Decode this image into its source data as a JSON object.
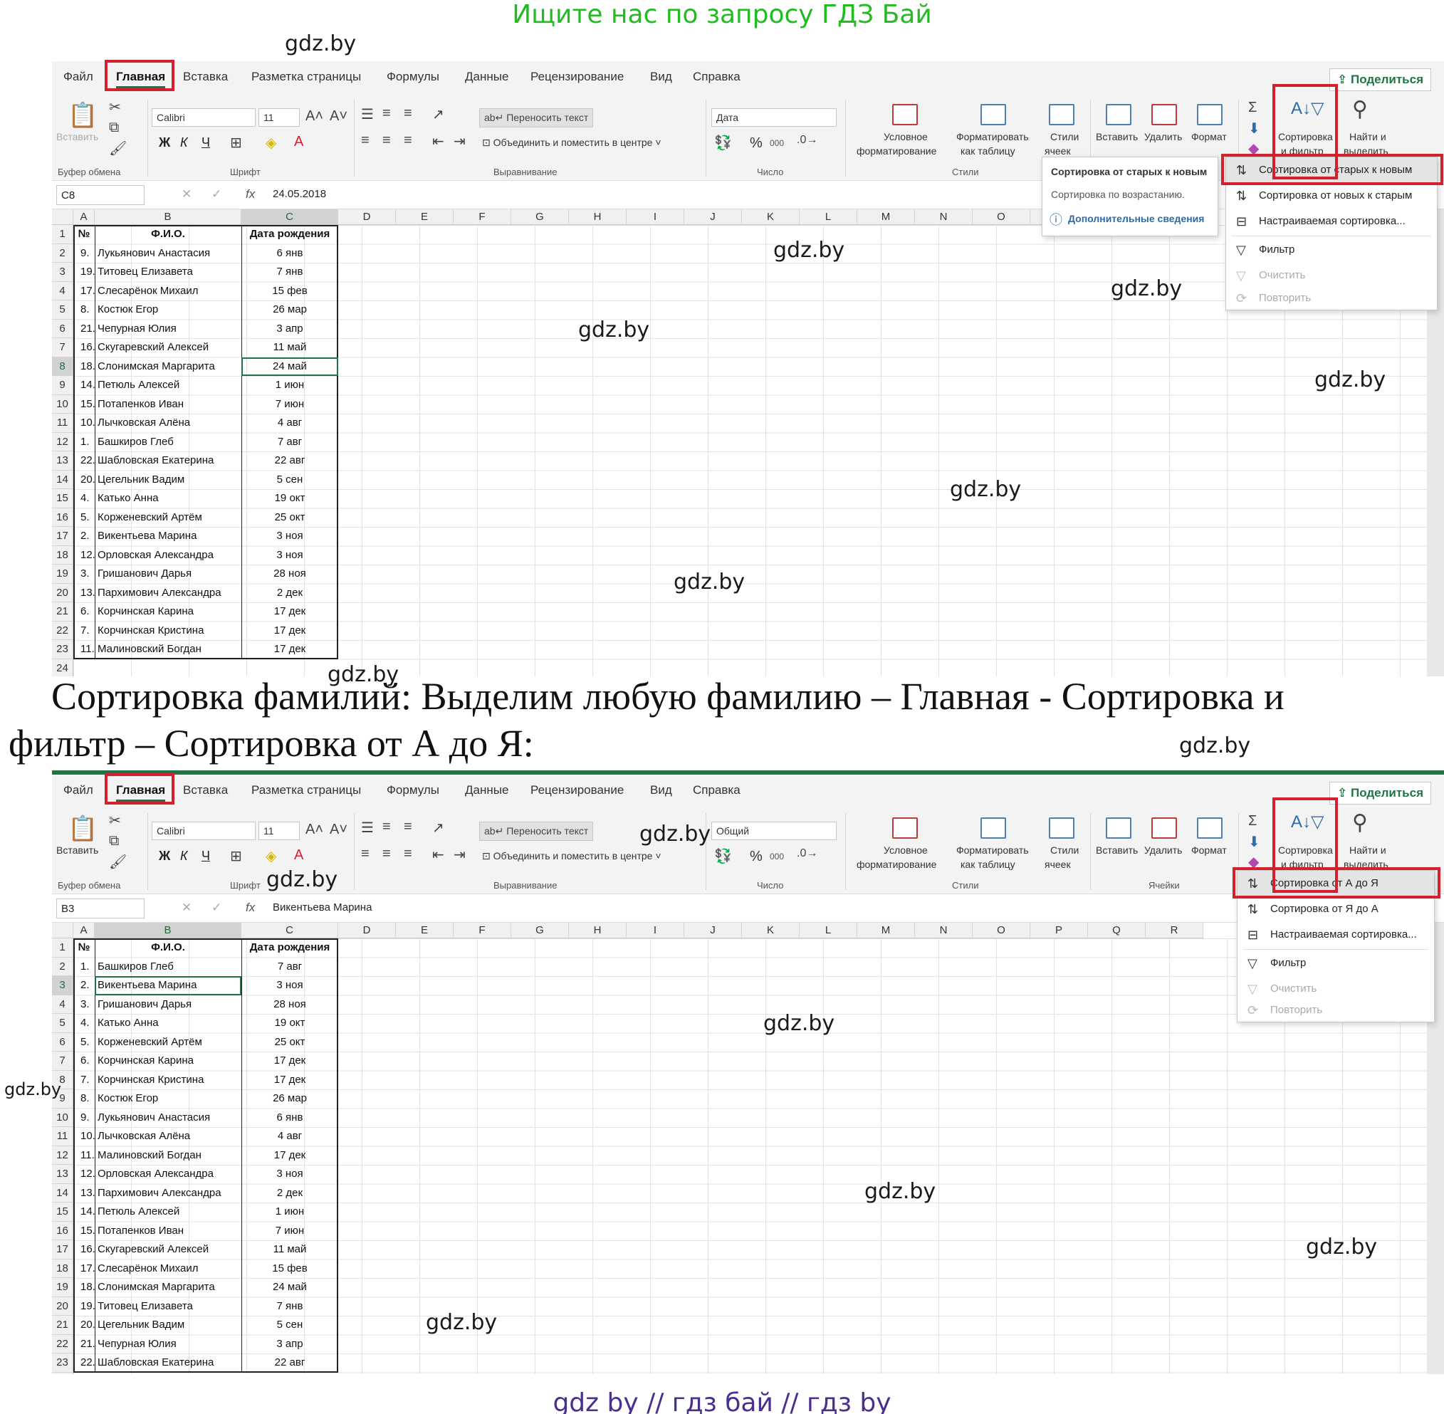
{
  "banner_top": "Ищите нас по запросу ГДЗ Бай",
  "banner_bottom": "gdz by  //  гдз бай  //  гдз by",
  "watermark": "gdz.by",
  "caption": {
    "line1": "Сортировка фамилий: Выделим любую фамилию – Главная -  Сортировка и",
    "line2": "фильтр – Сортировка от А до Я:"
  },
  "tabs": [
    "Файл",
    "Главная",
    "Вставка",
    "Разметка страницы",
    "Формулы",
    "Данные",
    "Рецензирование",
    "Вид",
    "Справка"
  ],
  "share_label": "Поделиться",
  "ribbon": {
    "paste": "Вставить",
    "font_name": "Calibri",
    "font_size": "11",
    "bold": "Ж",
    "italic": "К",
    "underline": "Ч",
    "wrap_text": "Переносить текст",
    "merge_center": "Объединить и поместить в центре",
    "percent": "%",
    "thousands": "000",
    "cond_format": [
      "Условное",
      "форматирование"
    ],
    "format_table": [
      "Форматировать",
      "как таблицу"
    ],
    "cell_styles": [
      "Стили",
      "ячеек"
    ],
    "insert": "Вставить",
    "delete": "Удалить",
    "format": "Формат",
    "sort_filter": [
      "Сортировка",
      "и фильтр"
    ],
    "find_select": [
      "Найти и",
      "выделить"
    ],
    "groups": {
      "clipboard": "Буфер обмена",
      "font": "Шрифт",
      "alignment": "Выравнивание",
      "number": "Число",
      "styles": "Стили",
      "cells": "Ячейки"
    }
  },
  "columns": [
    "A",
    "B",
    "C",
    "D",
    "E",
    "F",
    "G",
    "H",
    "I",
    "J",
    "K",
    "L",
    "M",
    "N",
    "O",
    "P",
    "Q",
    "R"
  ],
  "headers": {
    "num": "№",
    "fio": "Ф.И.О.",
    "date": "Дата рождения"
  },
  "panel1": {
    "number_format": "Дата",
    "namebox": "C8",
    "formula_value": "24.05.2018",
    "rows": [
      [
        "9.",
        "Лукьянович Анастасия",
        "6 янв"
      ],
      [
        "19.",
        "Титовец Елизавета",
        "7 янв"
      ],
      [
        "17.",
        "Слесарёнок Михаил",
        "15 фев"
      ],
      [
        "8.",
        "Костюк Егор",
        "26 мар"
      ],
      [
        "21.",
        "Чепурная Юлия",
        "3 апр"
      ],
      [
        "16.",
        "Скугаревский Алексей",
        "11 май"
      ],
      [
        "18.",
        "Слонимская Маргарита",
        "24 май"
      ],
      [
        "14.",
        "Петюль Алексей",
        "1 июн"
      ],
      [
        "15.",
        "Потапенков Иван",
        "7 июн"
      ],
      [
        "10.",
        "Лычковская Алёна",
        "4 авг"
      ],
      [
        "1.",
        "Башкиров Глеб",
        "7 авг"
      ],
      [
        "22.",
        "Шабловская Екатерина",
        "22 авг"
      ],
      [
        "20.",
        "Цегельник Вадим",
        "5 сен"
      ],
      [
        "4.",
        "Катько Анна",
        "19 окт"
      ],
      [
        "5.",
        "Корженевский Артём",
        "25 окт"
      ],
      [
        "2.",
        "Викентьева Марина",
        "3 ноя"
      ],
      [
        "12.",
        "Орловская Александра",
        "3 ноя"
      ],
      [
        "3.",
        "Гришанович Дарья",
        "28 ноя"
      ],
      [
        "13.",
        "Пархимович Александра",
        "2 дек"
      ],
      [
        "6.",
        "Корчинская Карина",
        "17 дек"
      ],
      [
        "7.",
        "Корчинская Кристина",
        "17 дек"
      ],
      [
        "11.",
        "Малиновский  Богдан",
        "17 дек"
      ]
    ],
    "tooltip": {
      "title": "Сортировка от старых к новым",
      "desc": "Сортировка по возрастанию.",
      "more": "Дополнительные сведения"
    },
    "menu": [
      "Сортировка от старых к новым",
      "Сортировка от новых к старым",
      "Настраиваемая сортировка...",
      "Фильтр",
      "Очистить",
      "Повторить"
    ]
  },
  "panel2": {
    "number_format": "Общий",
    "namebox": "B3",
    "formula_value": "Викентьева Марина",
    "rows": [
      [
        "1.",
        "Башкиров Глеб",
        "7 авг"
      ],
      [
        "2.",
        "Викентьева Марина",
        "3 ноя"
      ],
      [
        "3.",
        "Гришанович Дарья",
        "28 ноя"
      ],
      [
        "4.",
        "Катько Анна",
        "19 окт"
      ],
      [
        "5.",
        "Корженевский Артём",
        "25 окт"
      ],
      [
        "6.",
        "Корчинская Карина",
        "17 дек"
      ],
      [
        "7.",
        "Корчинская Кристина",
        "17 дек"
      ],
      [
        "8.",
        "Костюк Егор",
        "26 мар"
      ],
      [
        "9.",
        "Лукьянович Анастасия",
        "6 янв"
      ],
      [
        "10.",
        "Лычковская Алёна",
        "4 авг"
      ],
      [
        "11.",
        "Малиновский  Богдан",
        "17 дек"
      ],
      [
        "12.",
        "Орловская Александра",
        "3 ноя"
      ],
      [
        "13.",
        "Пархимович Александра",
        "2 дек"
      ],
      [
        "14.",
        "Петюль Алексей",
        "1 июн"
      ],
      [
        "15.",
        "Потапенков Иван",
        "7 июн"
      ],
      [
        "16.",
        "Скугаревский Алексей",
        "11 май"
      ],
      [
        "17.",
        "Слесарёнок Михаил",
        "15 фев"
      ],
      [
        "18.",
        "Слонимская Маргарита",
        "24 май"
      ],
      [
        "19.",
        "Титовец Елизавета",
        "7 янв"
      ],
      [
        "20.",
        "Цегельник Вадим",
        "5 сен"
      ],
      [
        "21.",
        "Чепурная Юлия",
        "3 апр"
      ],
      [
        "22.",
        "Шабловская Екатерина",
        "22 авг"
      ]
    ],
    "menu": [
      "Сортировка от А до Я",
      "Сортировка от Я до А",
      "Настраиваемая сортировка...",
      "Фильтр",
      "Очистить",
      "Повторить"
    ]
  }
}
